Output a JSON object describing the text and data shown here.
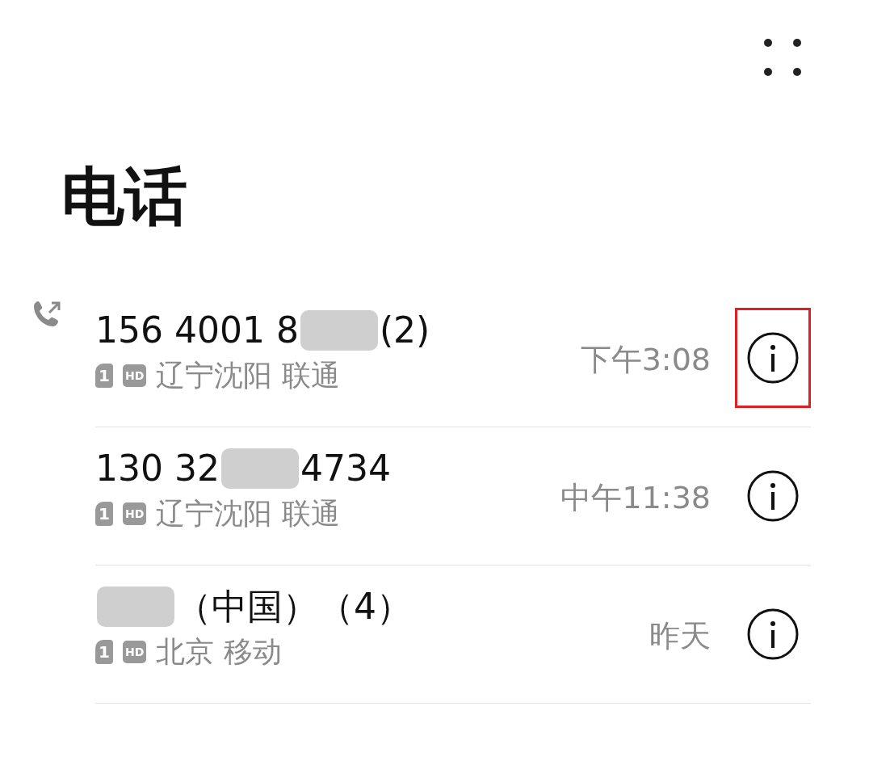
{
  "header": {
    "title": "电话"
  },
  "calls": [
    {
      "number_parts": [
        {
          "kind": "text",
          "text": "156 4001 8"
        },
        {
          "kind": "redacted"
        },
        {
          "kind": "text",
          "text": "(2)"
        }
      ],
      "outgoing": true,
      "sim": "1",
      "hd": "HD",
      "location": "辽宁沈阳 联通",
      "time": "下午3:08",
      "highlighted": true
    },
    {
      "number_parts": [
        {
          "kind": "text",
          "text": "130 32"
        },
        {
          "kind": "redacted"
        },
        {
          "kind": "text",
          "text": "4734"
        }
      ],
      "outgoing": false,
      "sim": "1",
      "hd": "HD",
      "location": "辽宁沈阳 联通",
      "time": "中午11:38",
      "highlighted": false
    },
    {
      "number_parts": [
        {
          "kind": "redacted"
        },
        {
          "kind": "text",
          "text": "（中国）（4）"
        }
      ],
      "outgoing": false,
      "sim": "1",
      "hd": "HD",
      "location": "北京 移动",
      "time": "昨天",
      "highlighted": false
    }
  ]
}
